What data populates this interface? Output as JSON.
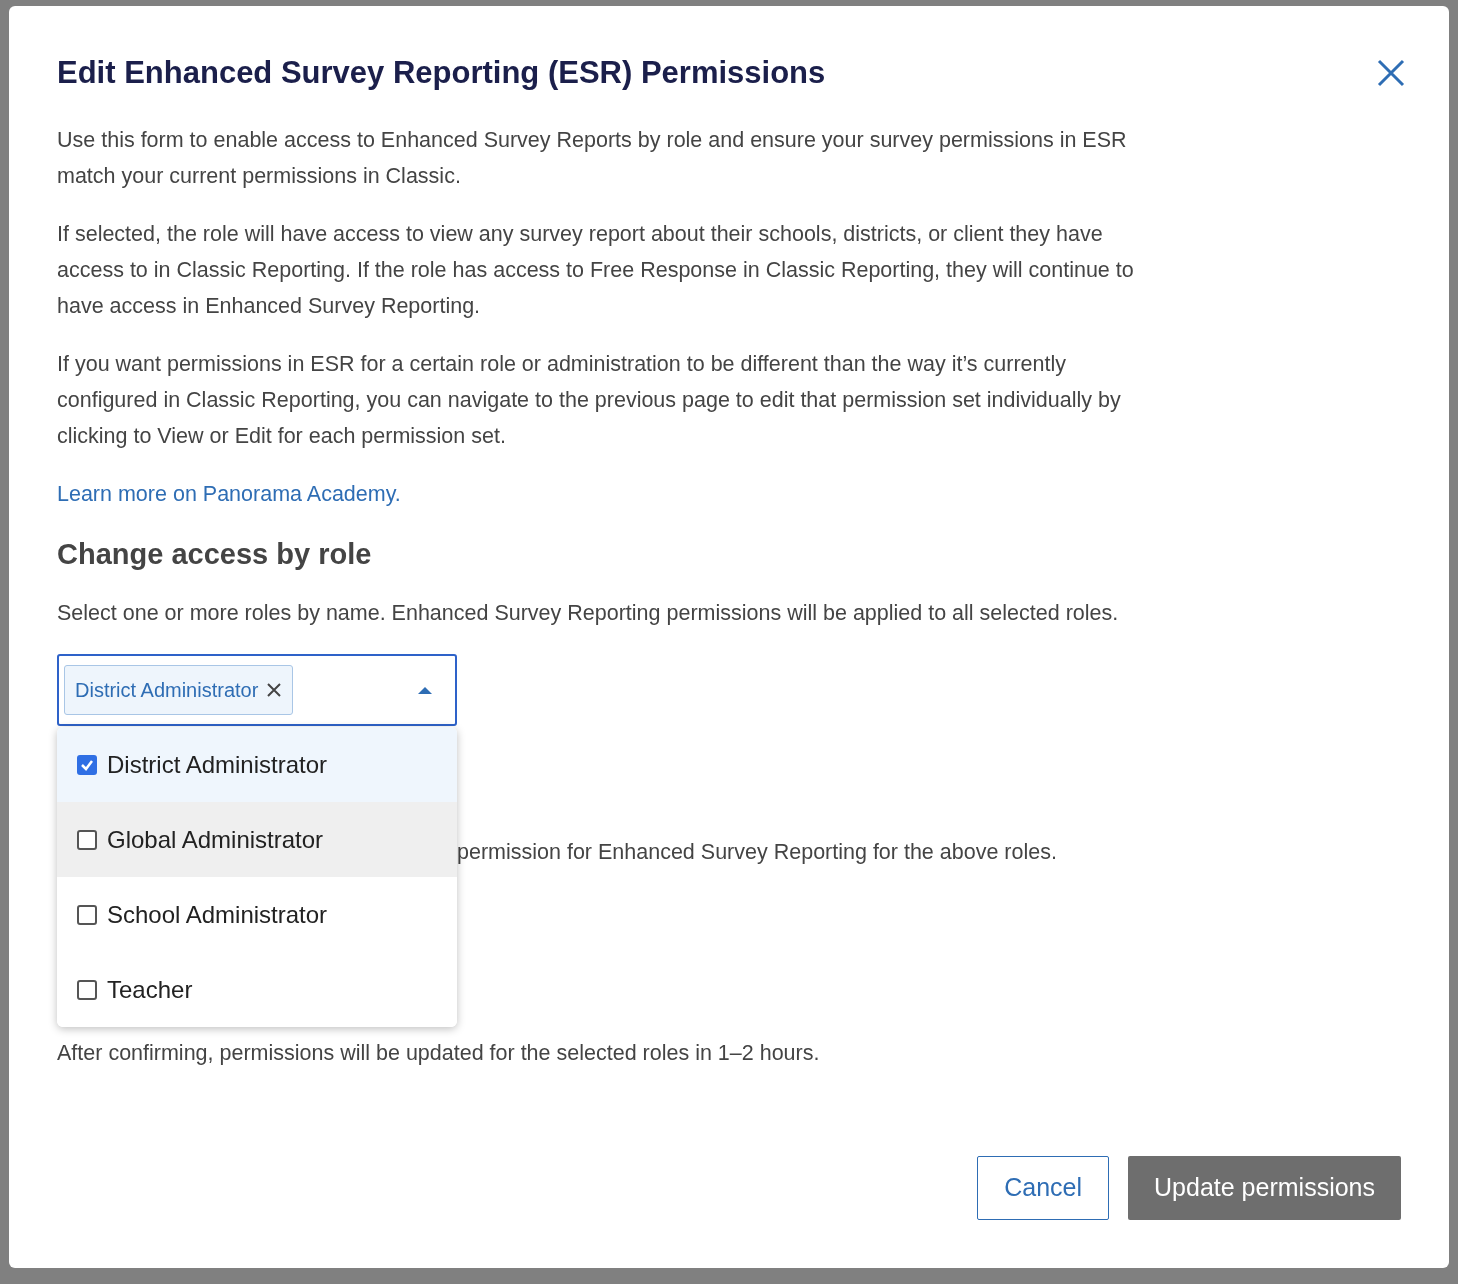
{
  "dialog": {
    "title": "Edit Enhanced Survey Reporting (ESR) Permissions",
    "paragraphs": [
      "Use this form to enable access to Enhanced Survey Reports by role and ensure your survey permissions in ESR match your current permissions in Classic.",
      "If selected, the role will have access to view any survey report about their schools, districts, or client they have access to in Classic Reporting. If the role has access to Free Response in Classic Reporting, they will continue to have access in Enhanced Survey Reporting.",
      "If you want permissions in ESR for a certain role or administration to be different than the way it’s currently configured in Classic Reporting, you can navigate to the previous page to edit that permission set individually by clicking to View or Edit for each permission set."
    ],
    "link": "Learn more on Panorama Academy.",
    "section_heading": "Change access by role",
    "section_text": "Select one or more roles by name. Enhanced Survey Reporting permissions will be applied to all selected roles.",
    "role_select": {
      "expanded": true,
      "chips": [
        "District Administrator"
      ],
      "options": [
        {
          "label": "District Administrator",
          "checked": true,
          "hovered": false
        },
        {
          "label": "Global Administrator",
          "checked": false,
          "hovered": true
        },
        {
          "label": "School Administrator",
          "checked": false,
          "hovered": false
        },
        {
          "label": "Teacher",
          "checked": false,
          "hovered": false
        }
      ]
    },
    "covered_text": "permission for Enhanced Survey Reporting for the above roles.",
    "note": "After confirming, permissions will be updated for the selected roles in 1–2 hours.",
    "buttons": [
      {
        "label": "Cancel",
        "kind": "secondary"
      },
      {
        "label": "Update permissions",
        "kind": "primary"
      }
    ]
  }
}
